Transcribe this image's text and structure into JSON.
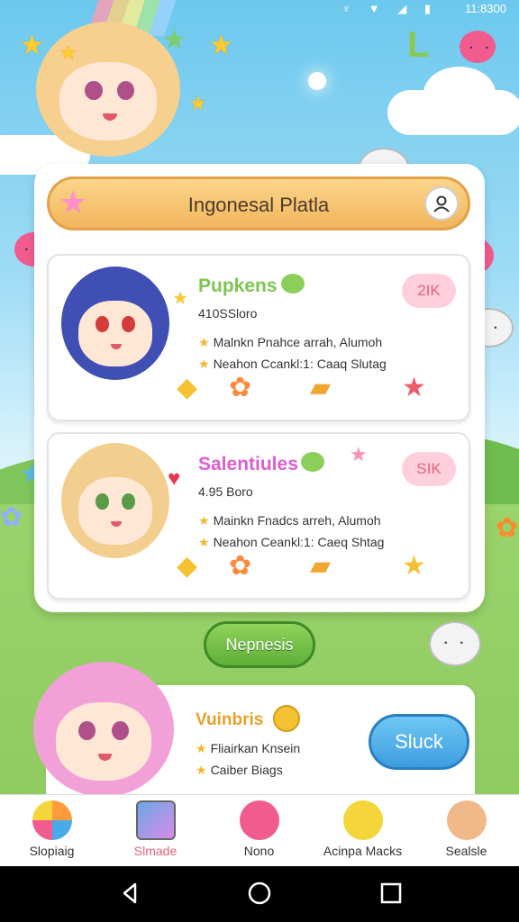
{
  "status_bar": {
    "icons": "♆ ▼ ◢ ▮",
    "time": "11:8300"
  },
  "header": {
    "title": "Ingonesal Platla"
  },
  "cards": [
    {
      "name": "Pupkens",
      "name_color": "#7cc552",
      "sub": "410SSloro",
      "badge": "2IK",
      "lines": [
        "Malnkn Pnahce arrah, Alumoh",
        "Neahon Ccankl:1: Caaq Slutag"
      ]
    },
    {
      "name": "Salentiules",
      "name_color": "#d95fd3",
      "sub": "4.95 Boro",
      "badge": "SIK",
      "lines": [
        "Mainkn Fnadcs arreh, Alumoh",
        "Neahon Ceankl:1: Caeq Shtag"
      ]
    }
  ],
  "next_button": {
    "label": "Nepnesis"
  },
  "card3": {
    "name": "Vuinbris",
    "lines": [
      "Fliairkan Knsein",
      "Caiber Biags"
    ],
    "action_label": "Sluck"
  },
  "nav": [
    {
      "label": "Slopiaig",
      "color": "#ff9a3d",
      "icon": "beachball-icon"
    },
    {
      "label": "Slmade",
      "color": "#6aa9e8",
      "icon": "gallery-icon"
    },
    {
      "label": "Nono",
      "color": "#f25b8e",
      "icon": "pink-blob-icon"
    },
    {
      "label": "Acinpa Macks",
      "color": "#f4d63b",
      "icon": "yellow-blob-icon"
    },
    {
      "label": "Sealsle",
      "color": "#f0b98a",
      "icon": "bear-icon"
    }
  ],
  "colors": {
    "accent_pink": "#e9607f",
    "green": "#6fbd4f",
    "blue": "#3d9ddf"
  }
}
